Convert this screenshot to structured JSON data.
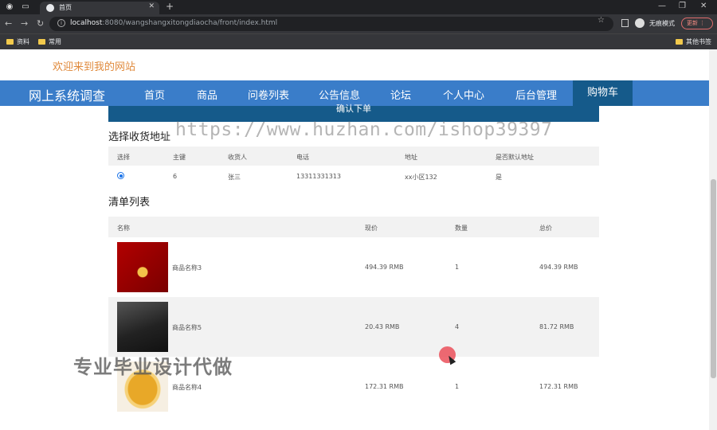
{
  "browser": {
    "tab_title": "首页",
    "url_host": "localhost",
    "url_rest": ":8080/wangshangxitongdiaocha/front/index.html",
    "incognito_label": "无痕模式",
    "update_label": "更新",
    "bookmarks": [
      "资料",
      "常用"
    ],
    "other_bookmarks": "其他书签"
  },
  "site": {
    "welcome": "欢迎来到我的网站",
    "brand": "网上系统调查",
    "nav": [
      "首页",
      "商品",
      "问卷列表",
      "公告信息",
      "论坛",
      "个人中心",
      "后台管理",
      "购物车"
    ],
    "active_nav": "购物车"
  },
  "order": {
    "confirm_label": "确认下单",
    "watermark": "https://www.huzhan.com/ishop39397"
  },
  "address": {
    "title": "选择收货地址",
    "headers": [
      "选择",
      "主键",
      "收货人",
      "电话",
      "地址",
      "是否默认地址"
    ],
    "rows": [
      {
        "id": "6",
        "name": "张三",
        "phone": "13311331313",
        "address": "xx小区132",
        "default": "是",
        "selected": true
      }
    ]
  },
  "items": {
    "title": "清单列表",
    "headers": [
      "名称",
      "现价",
      "数量",
      "总价"
    ],
    "rows": [
      {
        "name": "商品名称3",
        "price": "494.39 RMB",
        "qty": "1",
        "total": "494.39 RMB",
        "image": "necklace"
      },
      {
        "name": "商品名称5",
        "price": "20.43 RMB",
        "qty": "4",
        "total": "81.72 RMB",
        "image": "laptop"
      },
      {
        "name": "商品名称4",
        "price": "172.31 RMB",
        "qty": "1",
        "total": "172.31 RMB",
        "image": "gold-ring"
      }
    ]
  },
  "overlay": {
    "promo": "专业毕业设计代做"
  }
}
